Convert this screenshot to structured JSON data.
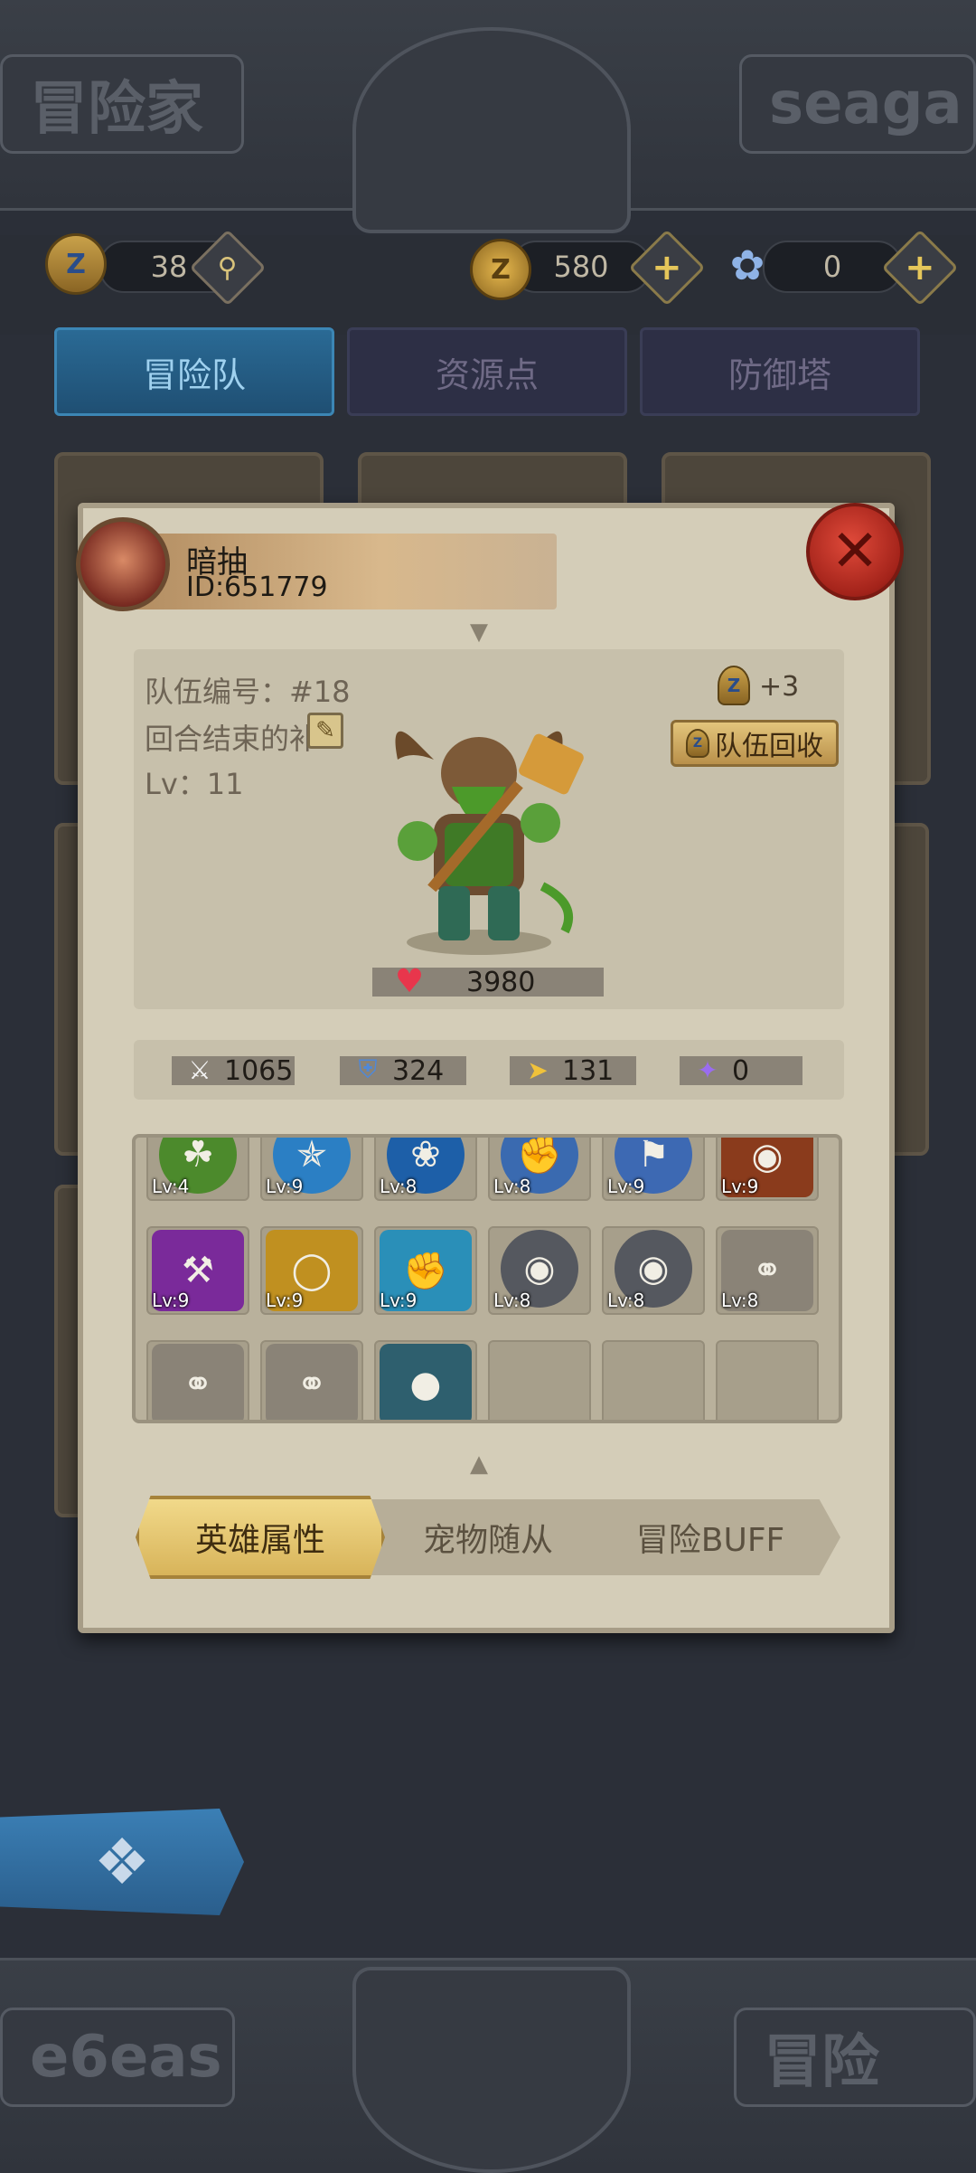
{
  "top_banner": {
    "left_plaque": "冒险家",
    "right_plaque": "seaga"
  },
  "bottom_banner": {
    "left_plaque": "e6eas",
    "right_plaque": "冒险"
  },
  "resources": {
    "badge_count": "38",
    "coins": "580",
    "shells": "0"
  },
  "tabs": [
    "冒险队",
    "资源点",
    "防御塔"
  ],
  "player": {
    "name": "暗抽",
    "id": "ID:651779"
  },
  "team": {
    "number_label": "队伍编号：#18",
    "round_end_label": "回合结束的补",
    "level_label": "Lv：11",
    "reward_label": "+3",
    "recycle_label": "队伍回收",
    "hp": "3980"
  },
  "stats": {
    "attack": "1065",
    "defense": "324",
    "speed": "131",
    "magic": "0"
  },
  "items": [
    {
      "icon": "tree-icon",
      "lv": "Lv:4",
      "color": "#4c8a2c"
    },
    {
      "icon": "shuriken-icon",
      "lv": "Lv:9",
      "color": "#2b7fc4"
    },
    {
      "icon": "turtle-shield-icon",
      "lv": "Lv:8",
      "color": "#1d5fa8"
    },
    {
      "icon": "fist-icon",
      "lv": "Lv:8",
      "color": "#3a6ab0"
    },
    {
      "icon": "banner-icon",
      "lv": "Lv:9",
      "color": "#3d69b3"
    },
    {
      "icon": "boar-icon",
      "lv": "Lv:9",
      "color": "#8a3b1c"
    },
    {
      "icon": "axe-icon",
      "lv": "Lv:9",
      "color": "#7a2a9a"
    },
    {
      "icon": "sack-icon",
      "lv": "Lv:9",
      "color": "#c09020"
    },
    {
      "icon": "fists-icon",
      "lv": "Lv:9",
      "color": "#2a8fb8"
    },
    {
      "icon": "helmet-icon",
      "lv": "Lv:8",
      "color": "#55585f"
    },
    {
      "icon": "helmet-icon",
      "lv": "Lv:8",
      "color": "#55585f"
    },
    {
      "icon": "amulet-icon",
      "lv": "Lv:8",
      "color": "#8a8377"
    },
    {
      "icon": "amulet-icon",
      "lv": "",
      "color": "#8a8377"
    },
    {
      "icon": "amulet-icon",
      "lv": "",
      "color": "#8a8377"
    },
    {
      "icon": "orb-icon",
      "lv": "",
      "color": "#2e5f6e"
    },
    {
      "icon": "",
      "lv": "",
      "color": ""
    },
    {
      "icon": "",
      "lv": "",
      "color": ""
    },
    {
      "icon": "",
      "lv": "",
      "color": ""
    }
  ],
  "bottom_tabs": [
    "英雄属性",
    "宠物随从",
    "冒险BUFF"
  ]
}
